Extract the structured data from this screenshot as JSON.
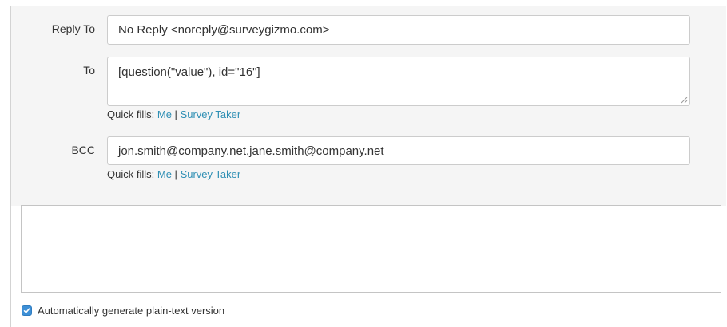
{
  "form": {
    "reply_to": {
      "label": "Reply To",
      "value": "No Reply <noreply@surveygizmo.com>"
    },
    "to": {
      "label": "To",
      "value": "[question(\"value\"), id=\"16\"]",
      "quick_fills_label": "Quick fills:",
      "quick_fill_me": "Me",
      "quick_fill_separator": "|",
      "quick_fill_survey_taker": "Survey Taker"
    },
    "bcc": {
      "label": "BCC",
      "value": "jon.smith@company.net,jane.smith@company.net",
      "quick_fills_label": "Quick fills:",
      "quick_fill_me": "Me",
      "quick_fill_separator": "|",
      "quick_fill_survey_taker": "Survey Taker"
    }
  },
  "editor": {
    "content": ""
  },
  "options": {
    "plain_text_label": "Automatically generate plain-text version",
    "plain_text_checked": true
  },
  "colors": {
    "link": "#2f8fb4",
    "checkbox": "#3d8fd6",
    "panel_bg": "#f5f5f5"
  }
}
